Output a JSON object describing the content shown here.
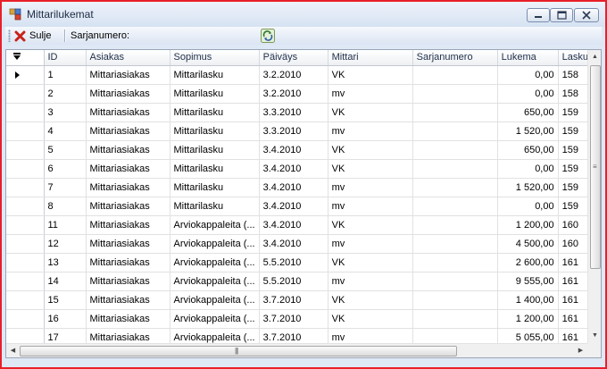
{
  "window": {
    "title": "Mittarilukemat"
  },
  "toolbar": {
    "close_label": "Sulje",
    "serial_label": "Sarjanumero:"
  },
  "grid": {
    "columns": [
      "ID",
      "Asiakas",
      "Sopimus",
      "Päiväys",
      "Mittari",
      "Sarjanumero",
      "Lukema",
      "Lasku"
    ],
    "rows": [
      [
        "1",
        "Mittariasiakas",
        "Mittarilasku",
        "3.2.2010",
        "VK",
        "",
        "0,00",
        "158"
      ],
      [
        "2",
        "Mittariasiakas",
        "Mittarilasku",
        "3.2.2010",
        "mv",
        "",
        "0,00",
        "158"
      ],
      [
        "3",
        "Mittariasiakas",
        "Mittarilasku",
        "3.3.2010",
        "VK",
        "",
        "650,00",
        "159"
      ],
      [
        "4",
        "Mittariasiakas",
        "Mittarilasku",
        "3.3.2010",
        "mv",
        "",
        "1 520,00",
        "159"
      ],
      [
        "5",
        "Mittariasiakas",
        "Mittarilasku",
        "3.4.2010",
        "VK",
        "",
        "650,00",
        "159"
      ],
      [
        "6",
        "Mittariasiakas",
        "Mittarilasku",
        "3.4.2010",
        "VK",
        "",
        "0,00",
        "159"
      ],
      [
        "7",
        "Mittariasiakas",
        "Mittarilasku",
        "3.4.2010",
        "mv",
        "",
        "1 520,00",
        "159"
      ],
      [
        "8",
        "Mittariasiakas",
        "Mittarilasku",
        "3.4.2010",
        "mv",
        "",
        "0,00",
        "159"
      ],
      [
        "11",
        "Mittariasiakas",
        "Arviokappaleita (...",
        "3.4.2010",
        "VK",
        "",
        "1 200,00",
        "160"
      ],
      [
        "12",
        "Mittariasiakas",
        "Arviokappaleita (...",
        "3.4.2010",
        "mv",
        "",
        "4 500,00",
        "160"
      ],
      [
        "13",
        "Mittariasiakas",
        "Arviokappaleita (...",
        "5.5.2010",
        "VK",
        "",
        "2 600,00",
        "161"
      ],
      [
        "14",
        "Mittariasiakas",
        "Arviokappaleita (...",
        "5.5.2010",
        "mv",
        "",
        "9 555,00",
        "161"
      ],
      [
        "15",
        "Mittariasiakas",
        "Arviokappaleita (...",
        "3.7.2010",
        "VK",
        "",
        "1 400,00",
        "161"
      ],
      [
        "16",
        "Mittariasiakas",
        "Arviokappaleita (...",
        "3.7.2010",
        "VK",
        "",
        "1 200,00",
        "161"
      ],
      [
        "17",
        "Mittariasiakas",
        "Arviokappaleita (...",
        "3.7.2010",
        "mv",
        "",
        "5 055,00",
        "161"
      ]
    ]
  }
}
